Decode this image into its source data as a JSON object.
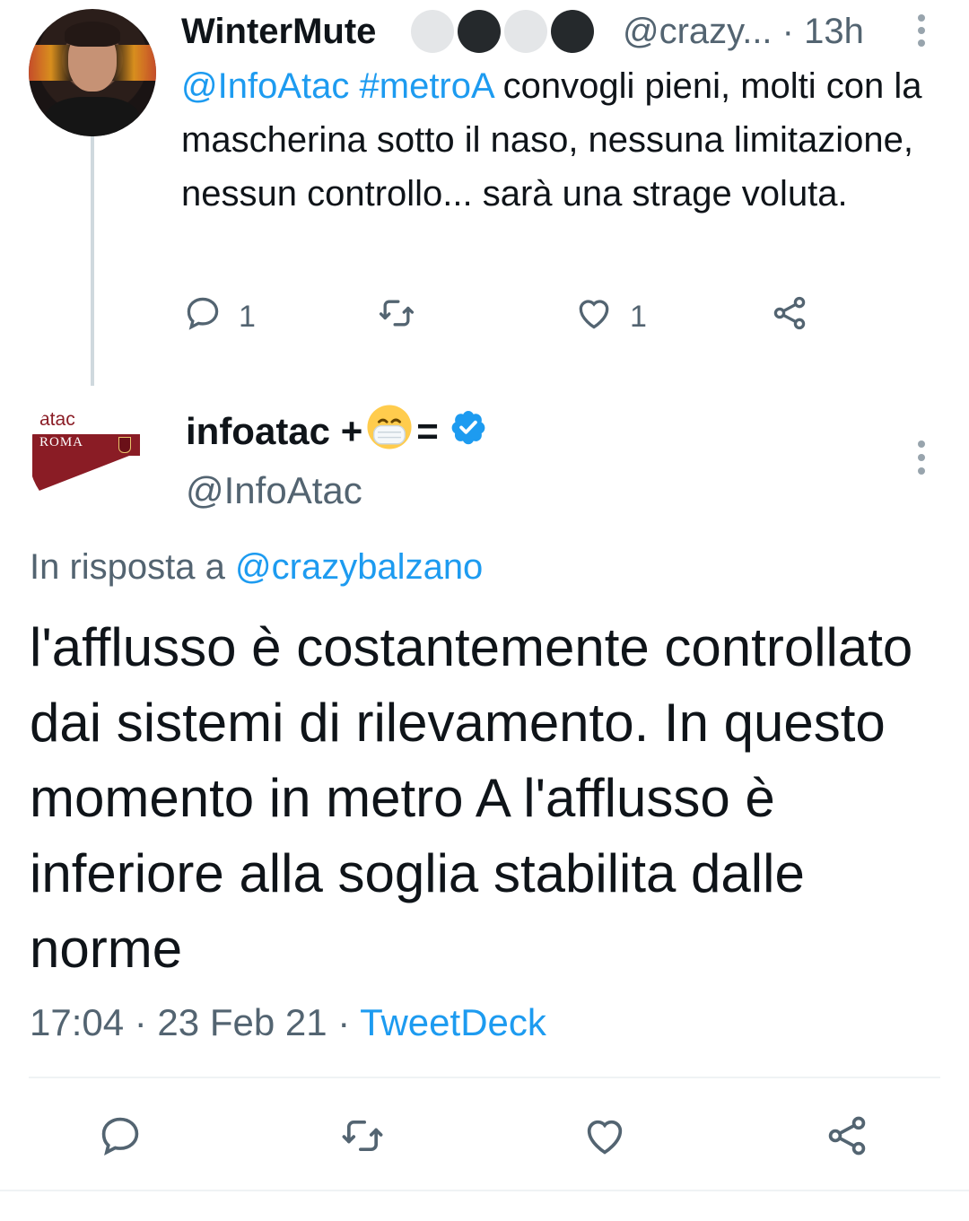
{
  "tweet_parent": {
    "display_name": "WinterMute",
    "name_dots": [
      "#e4e6e8",
      "#25292c",
      "#e4e6e8",
      "#25292c"
    ],
    "handle_time": "@crazy... · 13h",
    "text_mention": "@InfoAtac",
    "text_hashtag": "#metroA",
    "text_body": " convogli pieni, molti con la mascherina sotto il naso, nessuna limitazione, nessun controllo... sarà una strage voluta.",
    "actions": {
      "reply_count": "1",
      "like_count": "1"
    }
  },
  "tweet_main": {
    "avatar_word": "atac",
    "avatar_city": "ROMA",
    "display_name": "infoatac +",
    "display_name_suffix": "=",
    "handle": "@InfoAtac",
    "reply_prefix": "In risposta a ",
    "reply_handle": "@crazybalzano",
    "text": "l'afflusso è costantemente controllato dai sistemi di rilevamento. In questo momento in metro A l'afflusso è inferiore alla soglia stabilita dalle norme",
    "timestamp": "17:04 · 23 Feb 21 · ",
    "source": "TweetDeck"
  },
  "icons": [
    "reply-icon",
    "retweet-icon",
    "like-icon",
    "share-icon",
    "more-vertical-icon",
    "verified-badge-icon",
    "face-mask-emoji-icon"
  ],
  "colors": {
    "link": "#1d9bf0",
    "muted": "#536471",
    "text": "#0f1419",
    "verified": "#1d9bf0",
    "brand_red": "#8a1c25"
  }
}
